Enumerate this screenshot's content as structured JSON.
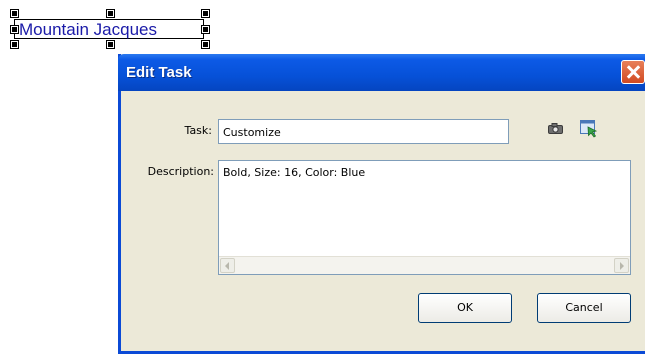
{
  "canvas": {
    "selected_label_text": "Mountain Jacques",
    "label_color": "#1a1aa8"
  },
  "dialog": {
    "title": "Edit Task",
    "task_label": "Task:",
    "task_value": "Customize",
    "description_label": "Description:",
    "description_value": "Bold, Size: 16, Color: Blue",
    "icons": [
      "camera-icon",
      "pick-element-icon"
    ],
    "ok_label": "OK",
    "cancel_label": "Cancel",
    "title_bar_color": "#0651d8",
    "close_button_color": "#d24a22"
  }
}
